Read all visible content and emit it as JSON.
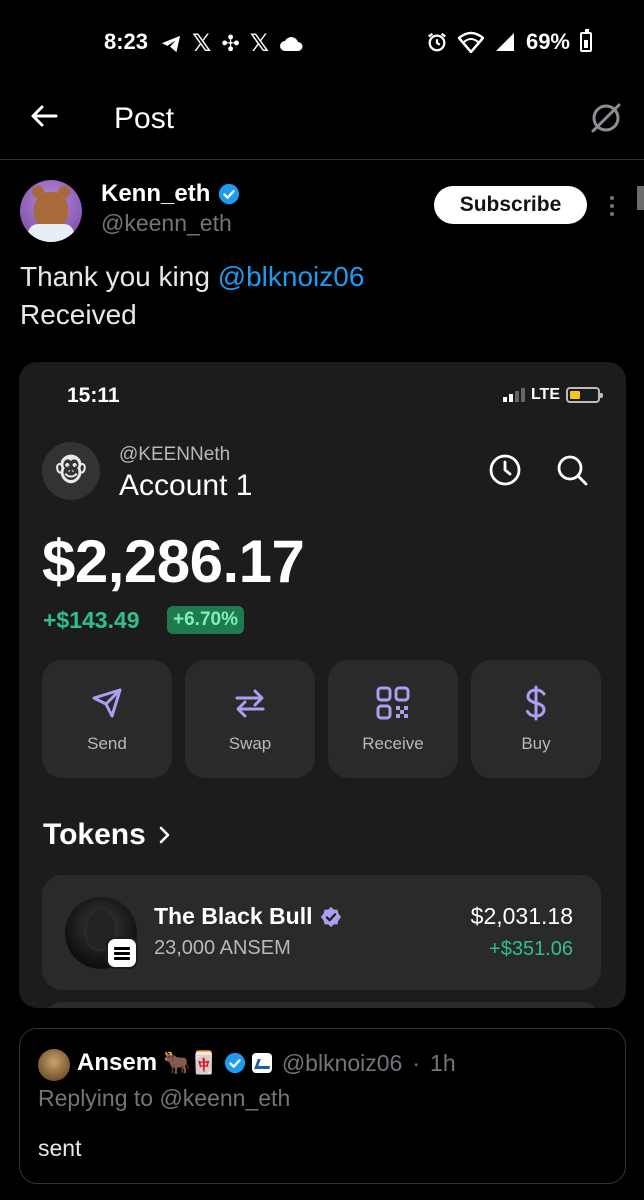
{
  "status_bar": {
    "time": "8:23",
    "battery": "69%"
  },
  "header": {
    "title": "Post"
  },
  "post": {
    "author_name": "Kenn_eth",
    "author_handle": "@keenn_eth",
    "subscribe_label": "Subscribe",
    "text_prefix": "Thank you king ",
    "mention": "@blknoiz06",
    "text_line2": "Received"
  },
  "wallet": {
    "time": "15:11",
    "network": "LTE",
    "account_handle": "@KEENNeth",
    "account_name": "Account 1",
    "account_avatar": "🐵",
    "balance": "$2,286.17",
    "change_abs": "+$143.49",
    "change_pct": "+6.70%",
    "actions": [
      {
        "label": "Send",
        "icon": "send-icon"
      },
      {
        "label": "Swap",
        "icon": "swap-icon"
      },
      {
        "label": "Receive",
        "icon": "qr-icon"
      },
      {
        "label": "Buy",
        "icon": "dollar-icon"
      }
    ],
    "tokens_title": "Tokens",
    "token": {
      "name": "The Black Bull",
      "amount": "23,000 ANSEM",
      "value": "$2,031.18",
      "change": "+$351.06"
    }
  },
  "quote": {
    "name": "Ansem",
    "emojis": "🐂🀄",
    "handle": "@blknoiz06",
    "time": "1h",
    "replying_to": "Replying to @keenn_eth",
    "text": "sent"
  },
  "colors": {
    "background": "#000000",
    "accent_blue": "#1d9bf0",
    "gain_green": "#2ec08b",
    "wallet_accent": "#ab9ff2",
    "card_bg": "#2a2a2a"
  }
}
